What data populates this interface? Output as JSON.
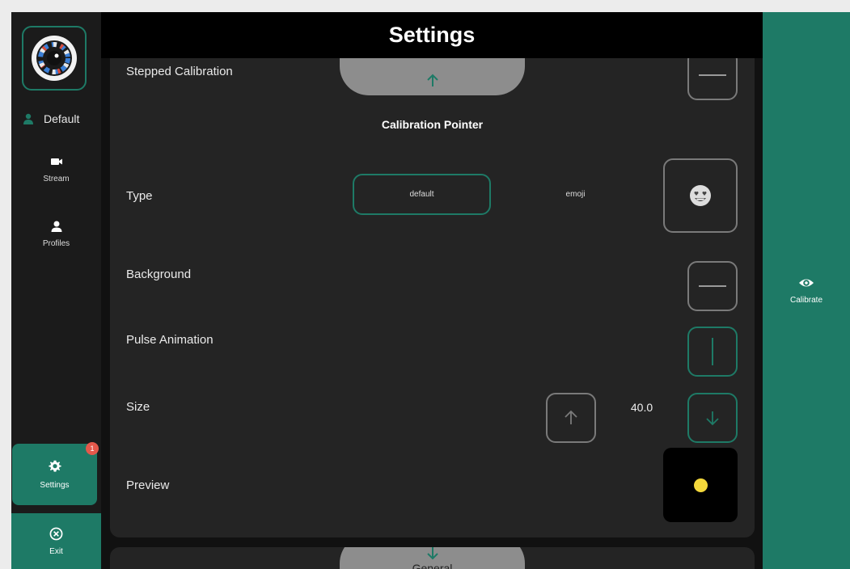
{
  "header": {
    "title": "Settings"
  },
  "sidebar": {
    "profile_name": "Default",
    "items": [
      {
        "label": "Stream",
        "icon": "video-camera-icon"
      },
      {
        "label": "Profiles",
        "icon": "person-icon"
      }
    ],
    "settings": {
      "label": "Settings",
      "badge": "1",
      "icon": "gear-icon"
    },
    "exit": {
      "label": "Exit",
      "icon": "close-circle-icon"
    }
  },
  "panel": {
    "stepped_calibration_label": "Stepped Calibration",
    "section_title": "Calibration Pointer",
    "type": {
      "label": "Type",
      "options": [
        "default",
        "emoji"
      ],
      "selected": "default",
      "emoji_icon": "heart-eyes-emoji-icon"
    },
    "background_label": "Background",
    "pulse_animation_label": "Pulse Animation",
    "size": {
      "label": "Size",
      "value": "40.0"
    },
    "preview": {
      "label": "Preview",
      "dot_color": "#f4d83b"
    }
  },
  "lower_panel": {
    "label": "General"
  },
  "right": {
    "calibrate_label": "Calibrate",
    "icon": "eye-icon"
  },
  "colors": {
    "accent": "#1e7a66",
    "panel": "#242424",
    "badge": "#e4584b"
  }
}
